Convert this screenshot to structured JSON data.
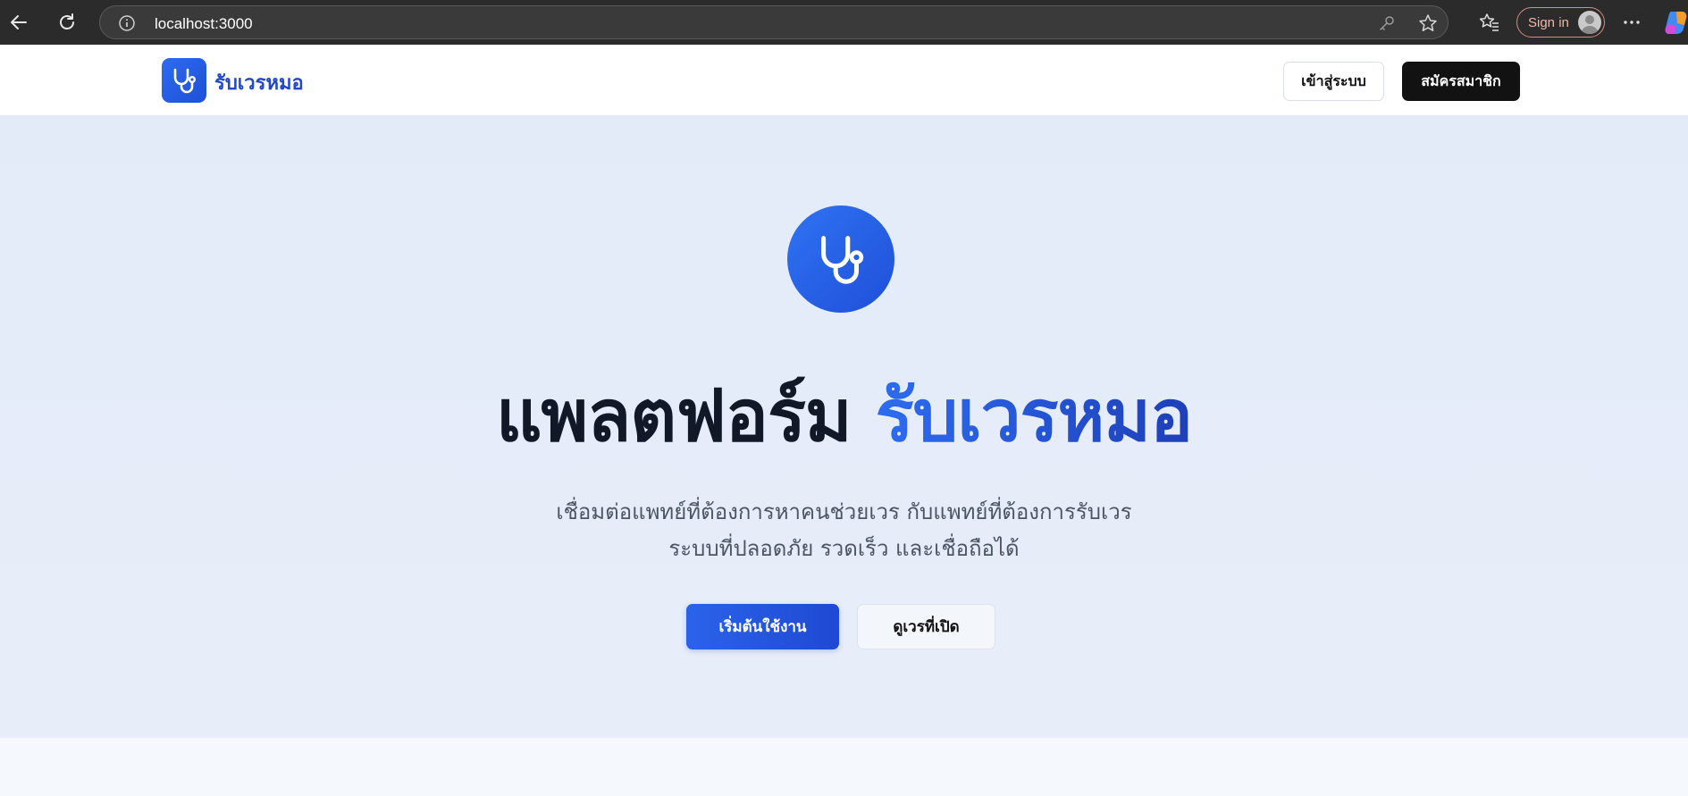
{
  "browser": {
    "url": "localhost:3000",
    "signin_label": "Sign in",
    "icons": [
      "back-arrow-icon",
      "reload-icon",
      "site-info-icon",
      "key-icon",
      "star-icon",
      "favorites-icon",
      "more-icon",
      "copilot-icon"
    ]
  },
  "header": {
    "brand": "รับเวรหมอ",
    "login_label": "เข้าสู่ระบบ",
    "register_label": "สมัครสมาชิก"
  },
  "hero": {
    "title_main": "แพลตฟอร์ม",
    "title_accent": "รับเวรหมอ",
    "subtitle_line1": "เชื่อมต่อแพทย์ที่ต้องการหาคนช่วยเวร กับแพทย์ที่ต้องการรับเวร",
    "subtitle_line2": "ระบบที่ปลอดภัย รวดเร็ว และเชื่อถือได้",
    "primary_cta": "เริ่มต้นใช้งาน",
    "secondary_cta": "ดูเวรที่เปิด"
  },
  "colors": {
    "brand_blue": "#2d6cf0",
    "brand_dark_blue": "#1e4fd8",
    "hero_bg": "#e5ecf9",
    "dark_button": "#121212"
  }
}
